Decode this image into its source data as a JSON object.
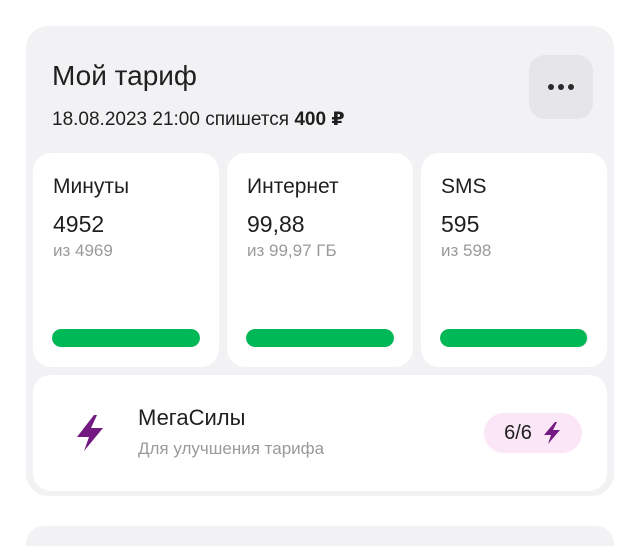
{
  "tariff": {
    "title": "Мой тариф",
    "date_text": "18.08.2023 21:00 спишется",
    "amount": "400 ₽"
  },
  "menu": {
    "icon": "more-horizontal-icon"
  },
  "counters": [
    {
      "label": "Минуты",
      "value": "4952",
      "total": "из 4969",
      "remaining_fraction": 0.997
    },
    {
      "label": "Интернет",
      "value": "99,88",
      "total": "из 99,97 ГБ",
      "remaining_fraction": 0.999
    },
    {
      "label": "SMS",
      "value": "595",
      "total": "из 598",
      "remaining_fraction": 0.995
    }
  ],
  "megasily": {
    "title": "МегаСилы",
    "subtitle": "Для улучшения тарифа",
    "badge": "6/6",
    "icon": "lightning-icon"
  },
  "colors": {
    "accent_green": "#00b956",
    "accent_purple": "#731982",
    "badge_bg": "#fbe6f7",
    "card_bg": "#f2f2f4"
  }
}
